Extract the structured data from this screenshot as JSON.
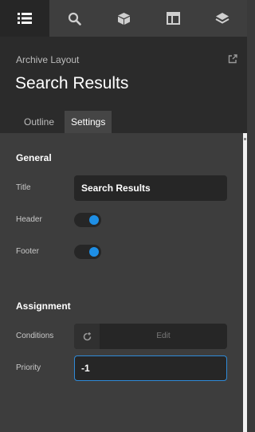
{
  "toolbar": {
    "items": [
      {
        "icon": "list-icon",
        "active": true
      },
      {
        "icon": "search-icon",
        "active": false
      },
      {
        "icon": "box-icon",
        "active": false
      },
      {
        "icon": "layout-icon",
        "active": false
      },
      {
        "icon": "layers-icon",
        "active": false
      }
    ]
  },
  "header": {
    "subtitle": "Archive Layout",
    "title": "Search Results",
    "export_icon": "export-icon"
  },
  "tabs": [
    {
      "label": "Outline",
      "active": false
    },
    {
      "label": "Settings",
      "active": true
    }
  ],
  "general": {
    "heading": "General",
    "title_label": "Title",
    "title_value": "Search Results",
    "header_label": "Header",
    "header_on": true,
    "footer_label": "Footer",
    "footer_on": true
  },
  "assignment": {
    "heading": "Assignment",
    "conditions_label": "Conditions",
    "conditions_icon": "refresh-plus-icon",
    "edit_label": "Edit",
    "priority_label": "Priority",
    "priority_value": "-1"
  },
  "colors": {
    "accent": "#1e8fe6",
    "focus_border": "#2f8ad8",
    "panel_bg": "#3d3d3d",
    "header_bg": "#2b2b2b"
  }
}
